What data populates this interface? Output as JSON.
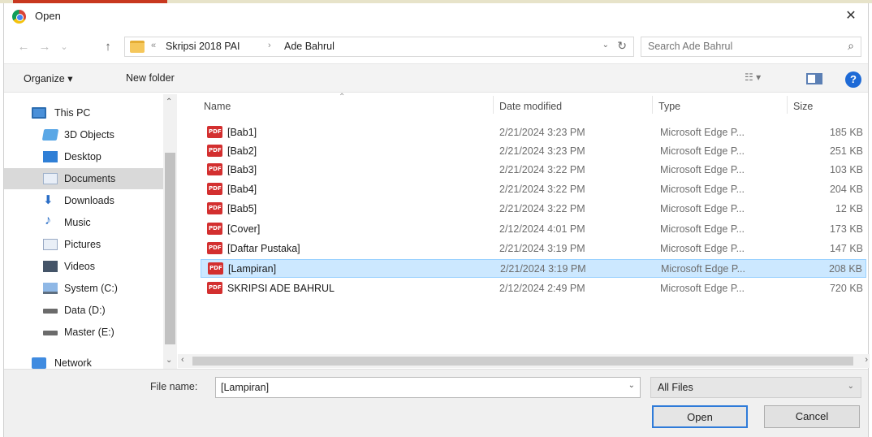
{
  "window": {
    "title": "Open",
    "close_glyph": "✕"
  },
  "nav": {
    "back_glyph": "←",
    "forward_glyph": "→",
    "recent_glyph": "⌄",
    "up_glyph": "↑"
  },
  "address": {
    "breadcrumb": [
      "Skripsi 2018 PAI",
      "Ade Bahrul"
    ],
    "separator": "›",
    "lead_separator": "«",
    "dropdown_glyph": "⌄",
    "refresh_glyph": "↻"
  },
  "search": {
    "placeholder": "Search Ade Bahrul",
    "icon_glyph": "⌕"
  },
  "toolbar": {
    "organize_label": "Organize ▾",
    "new_folder_label": "New folder",
    "view_label": "☷ ▾",
    "help_label": "?"
  },
  "sidebar": {
    "items": [
      {
        "label": "This PC",
        "icon": "pc-icon"
      },
      {
        "label": "3D Objects",
        "icon": "3d-objects-icon"
      },
      {
        "label": "Desktop",
        "icon": "desktop-icon"
      },
      {
        "label": "Documents",
        "icon": "documents-icon",
        "selected": true
      },
      {
        "label": "Downloads",
        "icon": "downloads-icon"
      },
      {
        "label": "Music",
        "icon": "music-icon"
      },
      {
        "label": "Pictures",
        "icon": "pictures-icon"
      },
      {
        "label": "Videos",
        "icon": "videos-icon"
      },
      {
        "label": "System (C:)",
        "icon": "drive-icon"
      },
      {
        "label": "Data (D:)",
        "icon": "drive-icon"
      },
      {
        "label": "Master (E:)",
        "icon": "drive-icon"
      },
      {
        "label": "Network",
        "icon": "network-icon"
      }
    ],
    "music_glyph": "♪",
    "down_glyph": "⬇",
    "scroll_up": "⌃",
    "scroll_down": "⌄"
  },
  "columns": {
    "name": "Name",
    "date": "Date modified",
    "type": "Type",
    "size": "Size",
    "sort_glyph": "⌃"
  },
  "files": [
    {
      "name": "[Bab1]",
      "date": "2/21/2024 3:23 PM",
      "type": "Microsoft Edge P...",
      "size": "185 KB"
    },
    {
      "name": "[Bab2]",
      "date": "2/21/2024 3:23 PM",
      "type": "Microsoft Edge P...",
      "size": "251 KB"
    },
    {
      "name": "[Bab3]",
      "date": "2/21/2024 3:22 PM",
      "type": "Microsoft Edge P...",
      "size": "103 KB"
    },
    {
      "name": "[Bab4]",
      "date": "2/21/2024 3:22 PM",
      "type": "Microsoft Edge P...",
      "size": "204 KB"
    },
    {
      "name": "[Bab5]",
      "date": "2/21/2024 3:22 PM",
      "type": "Microsoft Edge P...",
      "size": "12 KB"
    },
    {
      "name": "[Cover]",
      "date": "2/12/2024 4:01 PM",
      "type": "Microsoft Edge P...",
      "size": "173 KB"
    },
    {
      "name": "[Daftar Pustaka]",
      "date": "2/21/2024 3:19 PM",
      "type": "Microsoft Edge P...",
      "size": "147 KB"
    },
    {
      "name": "[Lampiran]",
      "date": "2/21/2024 3:19 PM",
      "type": "Microsoft Edge P...",
      "size": "208 KB",
      "selected": true
    },
    {
      "name": "SKRIPSI ADE BAHRUL",
      "date": "2/12/2024 2:49 PM",
      "type": "Microsoft Edge P...",
      "size": "720 KB"
    }
  ],
  "hscroll": {
    "left": "‹",
    "right": "›"
  },
  "footer": {
    "file_name_label": "File name:",
    "file_name_value": "[Lampiran]",
    "dropdown_glyph": "⌄",
    "file_type": "All Files",
    "open_label": "Open",
    "cancel_label": "Cancel"
  },
  "colors": {
    "selection_bg": "#cce8ff",
    "accent": "#2f7bd9",
    "pdf_red": "#d32f2f"
  }
}
